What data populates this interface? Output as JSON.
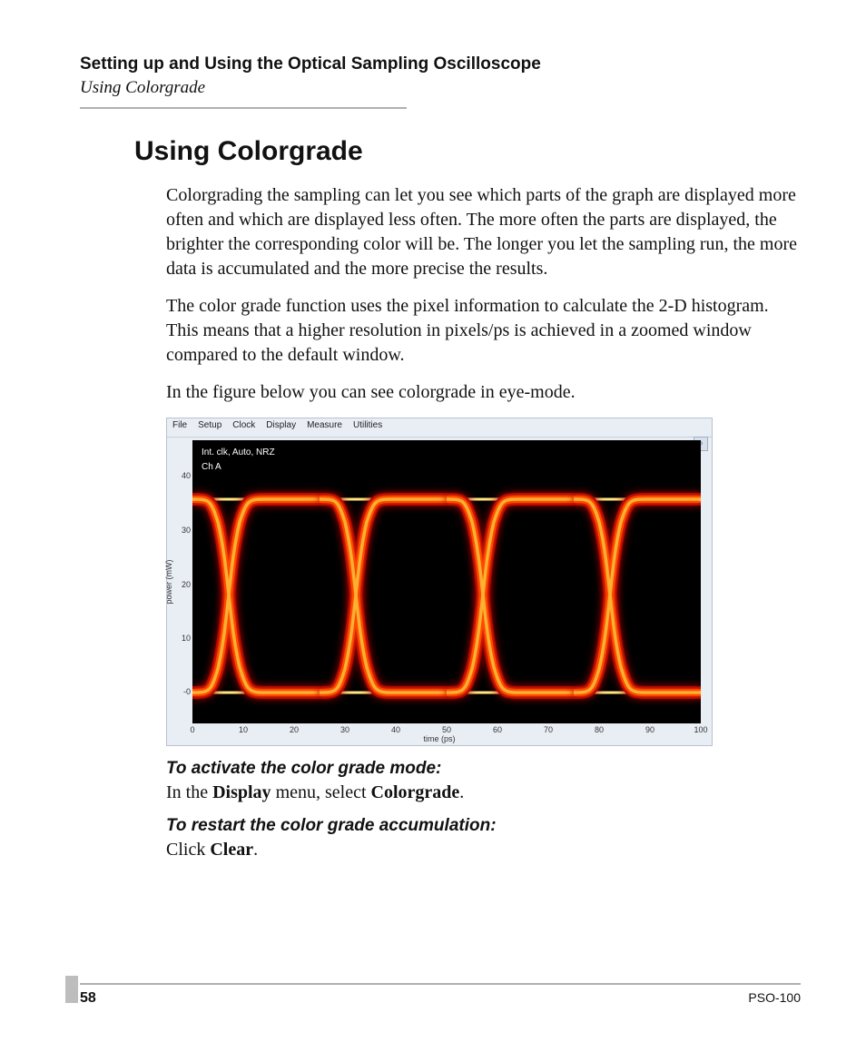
{
  "header": {
    "chapter": "Setting up and Using the Optical Sampling Oscilloscope",
    "section": "Using Colorgrade"
  },
  "title": "Using Colorgrade",
  "paragraphs": {
    "p1": "Colorgrading the sampling can let you see which parts of the graph are displayed more often and which are displayed less often. The more often the parts are displayed, the brighter the corresponding color will be. The longer you let the sampling run, the more data is accumulated and the more precise the results.",
    "p2": "The color grade function uses the pixel information to calculate the 2-D histogram. This means that a higher resolution in pixels/ps is achieved in a zoomed window compared to the default window.",
    "p3": "In the figure below you can see colorgrade in eye-mode."
  },
  "figure": {
    "menu": {
      "file": "File",
      "setup": "Setup",
      "clock": "Clock",
      "display": "Display",
      "measure": "Measure",
      "utilities": "Utilities"
    },
    "zoom_icon_glyph": "⌕",
    "annotation_line1": "Int. clk, Auto, NRZ",
    "annotation_line2": "Ch A",
    "xlabel": "time (ps)",
    "ylabel": "power (mW)",
    "xticks": [
      "0",
      "10",
      "20",
      "30",
      "40",
      "50",
      "60",
      "70",
      "80",
      "90",
      "100"
    ],
    "yticks": [
      "-0",
      "10",
      "20",
      "30",
      "40"
    ],
    "chart_kind": "eye-diagram-colorgrade"
  },
  "procedures": {
    "activate_heading": "To activate the color grade mode:",
    "activate_step_pre": "In the ",
    "activate_step_bold1": "Display",
    "activate_step_mid": " menu, select ",
    "activate_step_bold2": "Colorgrade",
    "activate_step_post": ".",
    "restart_heading": "To restart the color grade accumulation:",
    "restart_step_pre": "Click ",
    "restart_step_bold": "Clear",
    "restart_step_post": "."
  },
  "footer": {
    "page_number": "58",
    "model": "PSO-100"
  },
  "chart_data": {
    "type": "line",
    "title": "Eye diagram (colorgrade), Int. clk, Auto, NRZ, Ch A",
    "xlabel": "time (ps)",
    "ylabel": "power (mW)",
    "xlim": [
      0,
      100
    ],
    "ylim": [
      -2,
      45
    ],
    "bit_period_ps": 25,
    "x": [
      0,
      2,
      4,
      6,
      8,
      10,
      12,
      14,
      16,
      18,
      20,
      22,
      24,
      25
    ],
    "series": [
      {
        "name": "high rail (mW)",
        "values": [
          35,
          35,
          35,
          35,
          35,
          35,
          35,
          35,
          35,
          35,
          35,
          35,
          35,
          35
        ]
      },
      {
        "name": "low rail (mW)",
        "values": [
          0,
          0,
          0,
          0,
          0,
          0,
          0,
          0,
          0,
          0,
          0,
          0,
          0,
          0
        ]
      },
      {
        "name": "falling edge (mW)",
        "values": [
          35,
          35,
          34,
          30,
          24,
          17.5,
          11,
          5,
          1,
          0,
          0,
          0,
          0,
          0
        ]
      },
      {
        "name": "rising edge (mW)",
        "values": [
          0,
          0,
          1,
          5,
          11,
          17.5,
          24,
          30,
          34,
          35,
          35,
          35,
          35,
          35
        ]
      }
    ],
    "note": "Pattern repeats every ~25 ps across 0–100 ps (4 eye openings). Brightest (yellow/white) density along the 0 mW and 35 mW rails; transitions glow orange-red."
  }
}
